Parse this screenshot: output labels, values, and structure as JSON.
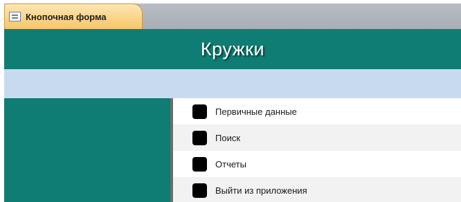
{
  "tab": {
    "label": "Кнопочная форма",
    "icon": "form-icon"
  },
  "form": {
    "title": "Кружки"
  },
  "menu": {
    "items": [
      {
        "label": "Первичные данные",
        "icon": "menu-button-icon"
      },
      {
        "label": "Поиск",
        "icon": "menu-button-icon"
      },
      {
        "label": "Отчеты",
        "icon": "menu-button-icon"
      },
      {
        "label": "Выйти из приложения",
        "icon": "menu-button-icon"
      }
    ]
  },
  "colors": {
    "header": "#0f7d73",
    "subheader": "#c8daf0",
    "tab_active": "#f7c66a",
    "tabstrip": "#b8bdc5",
    "row_alt": "#f2f2f2"
  }
}
